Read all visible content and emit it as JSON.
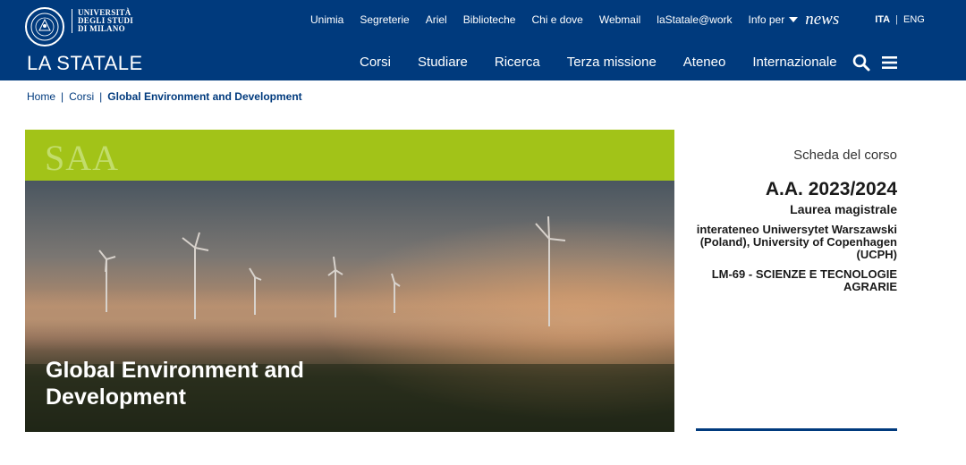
{
  "header": {
    "logo_lines": [
      "UNIVERSITÀ",
      "DEGLI STUDI",
      "DI MILANO"
    ],
    "brand": "LA STATALE",
    "utility_links": [
      "Unimia",
      "Segreterie",
      "Ariel",
      "Biblioteche",
      "Chi e dove",
      "Webmail",
      "laStatale@work"
    ],
    "info_per": "Info per",
    "news": "news",
    "lang": {
      "ita": "ITA",
      "eng": "ENG"
    },
    "main_nav": [
      "Corsi",
      "Studiare",
      "Ricerca",
      "Terza missione",
      "Ateneo",
      "Internazionale"
    ]
  },
  "breadcrumb": {
    "home": "Home",
    "corsi": "Corsi",
    "current": "Global Environment and Development"
  },
  "hero": {
    "band_label": "SAA",
    "title": "Global Environment and Development",
    "band_color": "#a2c318"
  },
  "sidebar": {
    "label": "Scheda del corso",
    "year": "A.A. 2023/2024",
    "degree": "Laurea magistrale",
    "interateneo": "interateneo Uniwersytet Warszawski (Poland), University of Copenhagen (UCPH)",
    "lm": "LM-69 - SCIENZE E TECNOLOGIE AGRARIE"
  },
  "colors": {
    "primary": "#003a7d",
    "accent": "#a2c318"
  },
  "icons": {
    "search": "search-icon",
    "menu": "hamburger-menu-icon",
    "dropdown": "caret-down-icon",
    "seal": "university-seal-icon"
  }
}
